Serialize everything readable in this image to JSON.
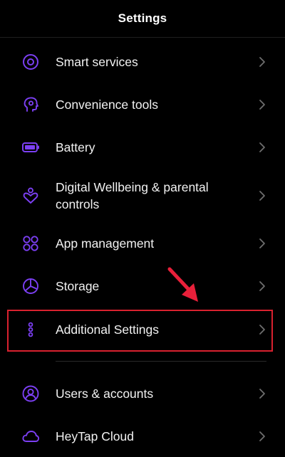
{
  "header": {
    "title": "Settings"
  },
  "accent_color": "#7b3ff2",
  "annotation_color": "#d9212f",
  "items": [
    {
      "id": "smart-services",
      "label": "Smart services",
      "icon": "target-circle-icon"
    },
    {
      "id": "convenience-tools",
      "label": "Convenience tools",
      "icon": "head-settings-icon"
    },
    {
      "id": "battery",
      "label": "Battery",
      "icon": "battery-icon"
    },
    {
      "id": "digital-wellbeing",
      "label": "Digital Wellbeing & parental controls",
      "icon": "heart-person-icon"
    },
    {
      "id": "app-management",
      "label": "App management",
      "icon": "app-grid-icon"
    },
    {
      "id": "storage",
      "label": "Storage",
      "icon": "pie-chart-icon"
    },
    {
      "id": "additional-settings",
      "label": "Additional Settings",
      "icon": "dots-vertical-icon"
    },
    {
      "id": "users-accounts",
      "label": "Users & accounts",
      "icon": "user-circle-icon"
    },
    {
      "id": "heytap-cloud",
      "label": "HeyTap Cloud",
      "icon": "cloud-icon"
    }
  ]
}
